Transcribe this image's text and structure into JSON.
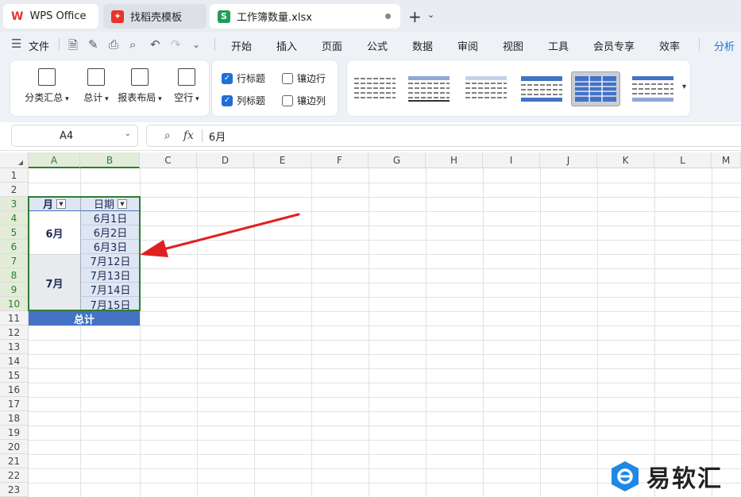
{
  "tabs": {
    "home": {
      "label": "WPS Office"
    },
    "template": {
      "label": "找稻壳模板"
    },
    "workbook": {
      "label": "工作簿数量.xlsx",
      "icon_letter": "S"
    }
  },
  "menu": {
    "file": "文件",
    "items": [
      "开始",
      "插入",
      "页面",
      "公式",
      "数据",
      "审阅",
      "视图",
      "工具",
      "会员专享",
      "效率",
      "分析"
    ]
  },
  "ribbon": {
    "buttons": [
      "分类汇总",
      "总计",
      "报表布局",
      "空行"
    ],
    "checkboxes": [
      {
        "label": "行标题",
        "checked": true
      },
      {
        "label": "镶边行",
        "checked": false
      },
      {
        "label": "列标题",
        "checked": true
      },
      {
        "label": "镶边列",
        "checked": false
      }
    ]
  },
  "formula": {
    "cell_ref": "A4",
    "fx": "fx",
    "value": "6月"
  },
  "grid": {
    "columns": [
      "A",
      "B",
      "C",
      "D",
      "E",
      "F",
      "G",
      "H",
      "I",
      "J",
      "K",
      "L",
      "M"
    ],
    "rows": [
      "1",
      "2",
      "3",
      "4",
      "5",
      "6",
      "7",
      "8",
      "9",
      "10",
      "11",
      "12",
      "13",
      "14",
      "15",
      "16",
      "17",
      "18",
      "19",
      "20",
      "21",
      "22",
      "23"
    ],
    "header_month": "月",
    "header_date": "日期",
    "month_june": "6月",
    "month_july": "7月",
    "dates": [
      "6月1日",
      "6月2日",
      "6月3日",
      "7月12日",
      "7月13日",
      "7月14日",
      "7月15日"
    ],
    "total": "总计"
  },
  "watermark": {
    "text": "易软汇"
  },
  "colors": {
    "accent": "#1f6fd6",
    "selection": "#2e7d32",
    "total_bg": "#4472c4",
    "arrow": "#e02020",
    "wps_red": "#e8342a",
    "sheet_green": "#1e9e57"
  }
}
